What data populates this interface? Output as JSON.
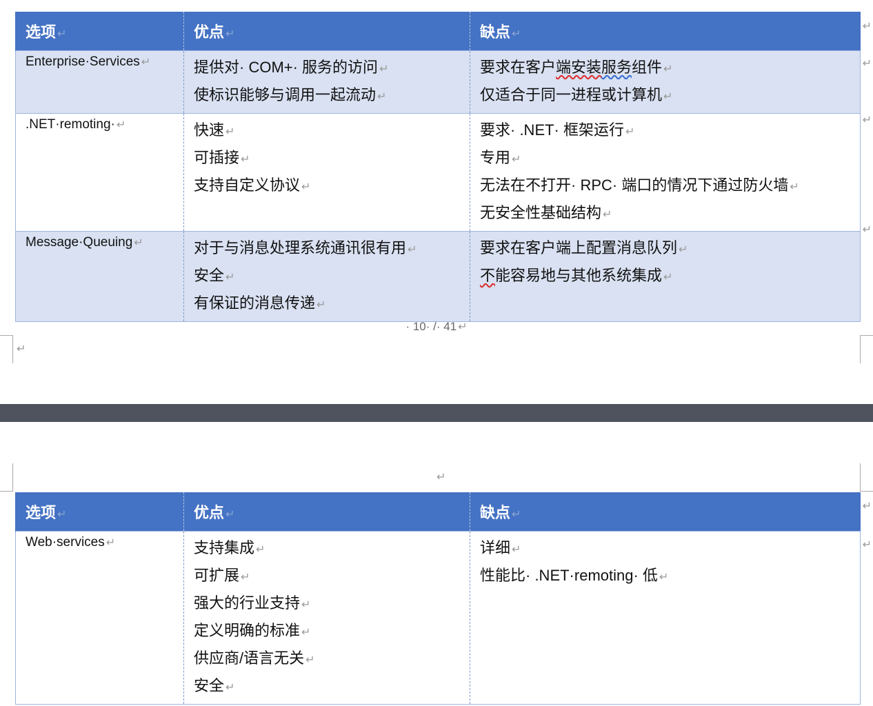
{
  "headers": {
    "option": "选项",
    "pros": "优点",
    "cons": "缺点"
  },
  "paragraph_mark": "↵",
  "page1": {
    "rows": [
      {
        "option": "Enterprise·Services",
        "pros": [
          "提供对· COM+· 服务的访问",
          "使标识能够与调用一起流动"
        ],
        "cons_prefix": "要求在客户",
        "cons_squiggle_red": "端安装",
        "cons_squiggle_blue": "服务",
        "cons_suffix": "组件",
        "cons": [
          "仅适合于同一进程或计算机"
        ]
      },
      {
        "option": ".NET·remoting·",
        "pros": [
          "快速",
          "可插接",
          "支持自定义协议"
        ],
        "cons": [
          "要求· .NET· 框架运行",
          "专用",
          "无法在不打开· RPC· 端口的情况下通过防火墙",
          "无安全性基础结构"
        ]
      },
      {
        "option": "Message·Queuing",
        "pros": [
          "对于与消息处理系统通讯很有用",
          "安全",
          "有保证的消息传递"
        ],
        "cons_first": "要求在客户端上配置消息队列",
        "cons_squiggle_red": "不",
        "cons_suffix": "能容易地与其他系统集成"
      }
    ],
    "page_number": "· 10· /· 41"
  },
  "page2": {
    "rows": [
      {
        "option": "Web·services",
        "pros": [
          "支持集成",
          "可扩展",
          "强大的行业支持",
          "定义明确的标准",
          "供应商/语言无关",
          "安全"
        ],
        "cons": [
          "详细",
          "性能比· .NET·remoting· 低"
        ]
      }
    ]
  }
}
